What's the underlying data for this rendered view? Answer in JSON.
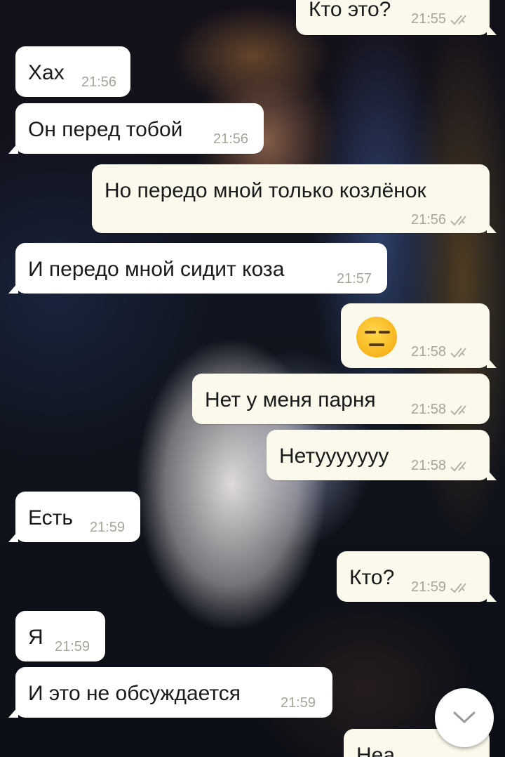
{
  "chat": {
    "messages": [
      {
        "dir": "out",
        "text": "Кто это?",
        "time": "21:55",
        "read": true
      },
      {
        "dir": "in",
        "text": "Хах",
        "time": "21:56"
      },
      {
        "dir": "in",
        "text": "Он перед тобой",
        "time": "21:56"
      },
      {
        "dir": "out",
        "text": "Но передо мной только козлёнок",
        "time": "21:56",
        "read": true
      },
      {
        "dir": "in",
        "text": "И передо мной сидит коза",
        "time": "21:57"
      },
      {
        "dir": "out",
        "text": "",
        "emoji": "expressionless-face-emoji",
        "time": "21:58",
        "read": true
      },
      {
        "dir": "out",
        "text": "Нет у меня парня",
        "time": "21:58",
        "read": true
      },
      {
        "dir": "out",
        "text": "Нетууууууу",
        "time": "21:58",
        "read": true
      },
      {
        "dir": "in",
        "text": "Есть",
        "time": "21:59"
      },
      {
        "dir": "out",
        "text": "Кто?",
        "time": "21:59",
        "read": true
      },
      {
        "dir": "in",
        "text": "Я",
        "time": "21:59"
      },
      {
        "dir": "in",
        "text": "И это не обсуждается",
        "time": "21:59"
      },
      {
        "dir": "out",
        "text": "Неа",
        "time": "",
        "read": false
      }
    ]
  },
  "icons": {
    "read_receipt": "double-check-icon",
    "scroll_down": "chevron-down-icon"
  },
  "colors": {
    "outgoing_bubble": "#fbf8ec",
    "incoming_bubble": "#ffffff",
    "time_text": "#a5a59a",
    "check_color": "#b5b3a6"
  }
}
